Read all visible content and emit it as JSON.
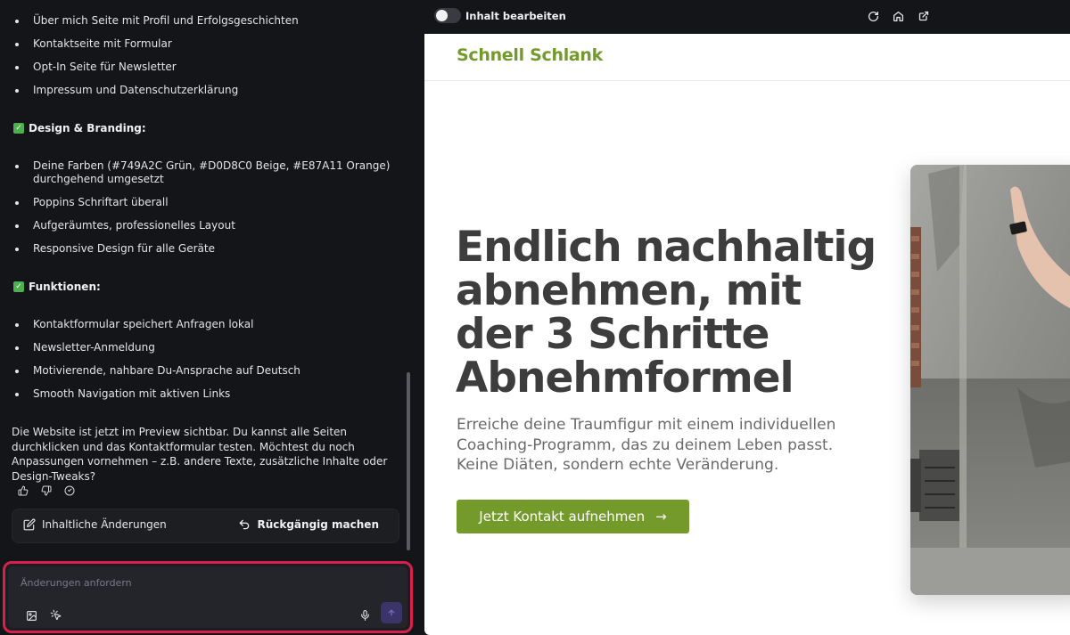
{
  "chat": {
    "bullets_top": [
      "Über mich Seite mit Profil und Erfolgsgeschichten",
      "Kontaktseite mit Formular",
      "Opt-In Seite für Newsletter",
      "Impressum und Datenschutzerklärung"
    ],
    "section_design": "Design & Branding:",
    "bullets_design": [
      "Deine Farben (#749A2C Grün, #D0D8C0 Beige, #E87A11 Orange) durchgehend umgesetzt",
      "Poppins Schriftart überall",
      "Aufgeräumtes, professionelles Layout",
      "Responsive Design für alle Geräte"
    ],
    "section_functions": "Funktionen:",
    "bullets_functions": [
      "Kontaktformular speichert Anfragen lokal",
      "Newsletter-Anmeldung",
      "Motivierende, nahbare Du-Ansprache auf Deutsch",
      "Smooth Navigation mit aktiven Links"
    ],
    "summary": "Die Website ist jetzt im Preview sichtbar. Du kannst alle Seiten durchklicken und das Kontaktformular testen. Möchtest du noch Anpassungen vornehmen – z.B. andere Texte, zusätzliche Inhalte oder Design-Tweaks?",
    "actions": {
      "edit_content": "Inhaltliche Änderungen",
      "undo": "Rückgängig machen"
    }
  },
  "composer": {
    "placeholder": "Änderungen anfordern",
    "highlight_color": "#d8204a"
  },
  "preview_toolbar": {
    "toggle_label": "Inhalt bearbeiten",
    "toggle_on": false
  },
  "site": {
    "brand": "Schnell Schlank",
    "hero_title": "Endlich nachhaltig abnehmen, mit der 3 Schritte Abnehmformel",
    "hero_subtitle": "Erreiche deine Traumfigur mit einem individuellen Coaching-Programm, das zu deinem Leben passt. Keine Diäten, sondern echte Veränderung.",
    "cta_label": "Jetzt Kontakt aufnehmen",
    "cta_arrow": "→",
    "colors": {
      "green": "#749A2C",
      "beige": "#D0D8C0",
      "orange": "#E87A11"
    }
  }
}
